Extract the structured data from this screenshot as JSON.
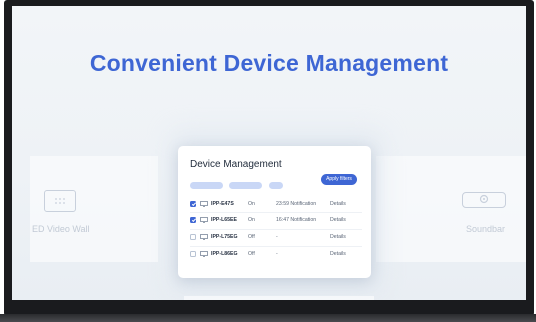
{
  "headline": "Convenient Device Management",
  "left_card": {
    "label": "ED Video Wall",
    "icon": "video-wall-icon"
  },
  "right_card": {
    "label": "Soundbar",
    "icon": "soundbar-icon"
  },
  "panel": {
    "title": "Device Management",
    "apply_label": "Apply filters",
    "rows": [
      {
        "checked": true,
        "name": "IPP-E47S",
        "status": "On",
        "notification": "23:59 Notification",
        "action": "Details"
      },
      {
        "checked": true,
        "name": "IPP-L65EE",
        "status": "On",
        "notification": "16:47 Notification",
        "action": "Details"
      },
      {
        "checked": false,
        "name": "IPP-L75EG",
        "status": "Off",
        "notification": "-",
        "action": "Details"
      },
      {
        "checked": false,
        "name": "IPP-L86EG",
        "status": "Off",
        "notification": "-",
        "action": "Details"
      }
    ]
  },
  "colors": {
    "accent": "#3e66d4",
    "bezel": "#1a1b1e",
    "screen_bg": "#eef2f6"
  }
}
